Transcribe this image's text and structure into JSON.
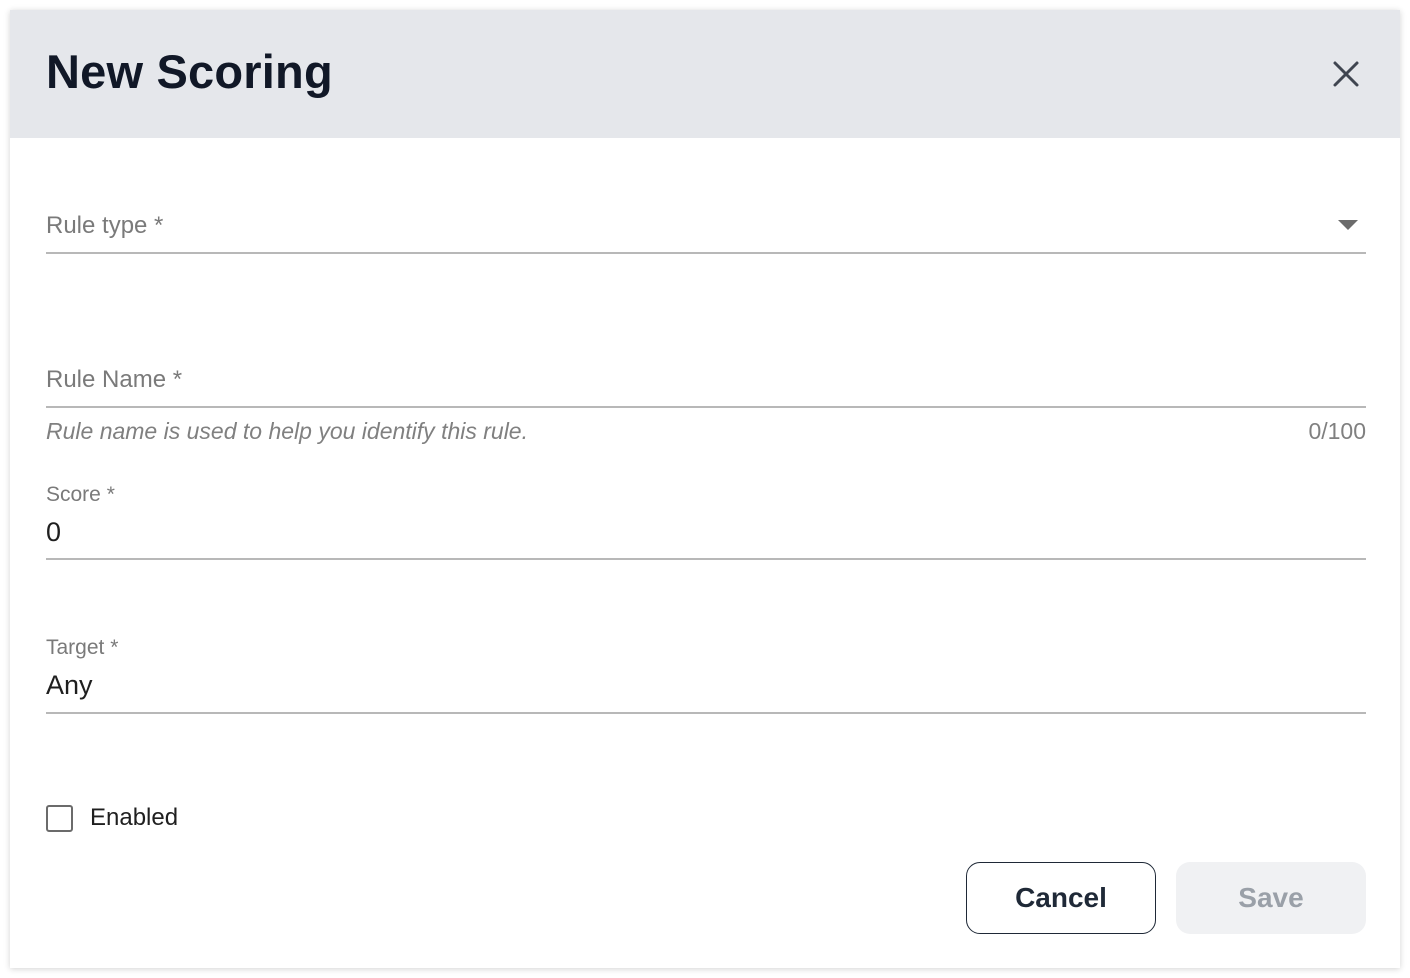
{
  "dialog": {
    "title": "New Scoring"
  },
  "form": {
    "rule_type": {
      "label": "Rule type *",
      "value": ""
    },
    "rule_name": {
      "label": "Rule Name *",
      "value": "",
      "helper": "Rule name is used to help you identify this rule.",
      "counter": "0/100"
    },
    "score": {
      "label": "Score *",
      "value": "0"
    },
    "target": {
      "label": "Target *",
      "value": "Any"
    },
    "enabled": {
      "label": "Enabled",
      "checked": false
    }
  },
  "actions": {
    "cancel_label": "Cancel",
    "save_label": "Save",
    "save_disabled": true
  },
  "icons": {
    "close": "close-icon",
    "dropdown": "chevron-down-icon",
    "checkbox": "checkbox-icon"
  },
  "colors": {
    "header_bg": "#e5e7eb",
    "title": "#111827",
    "save_disabled_bg": "#f0f1f3",
    "save_disabled_text": "#9aa0a8"
  }
}
